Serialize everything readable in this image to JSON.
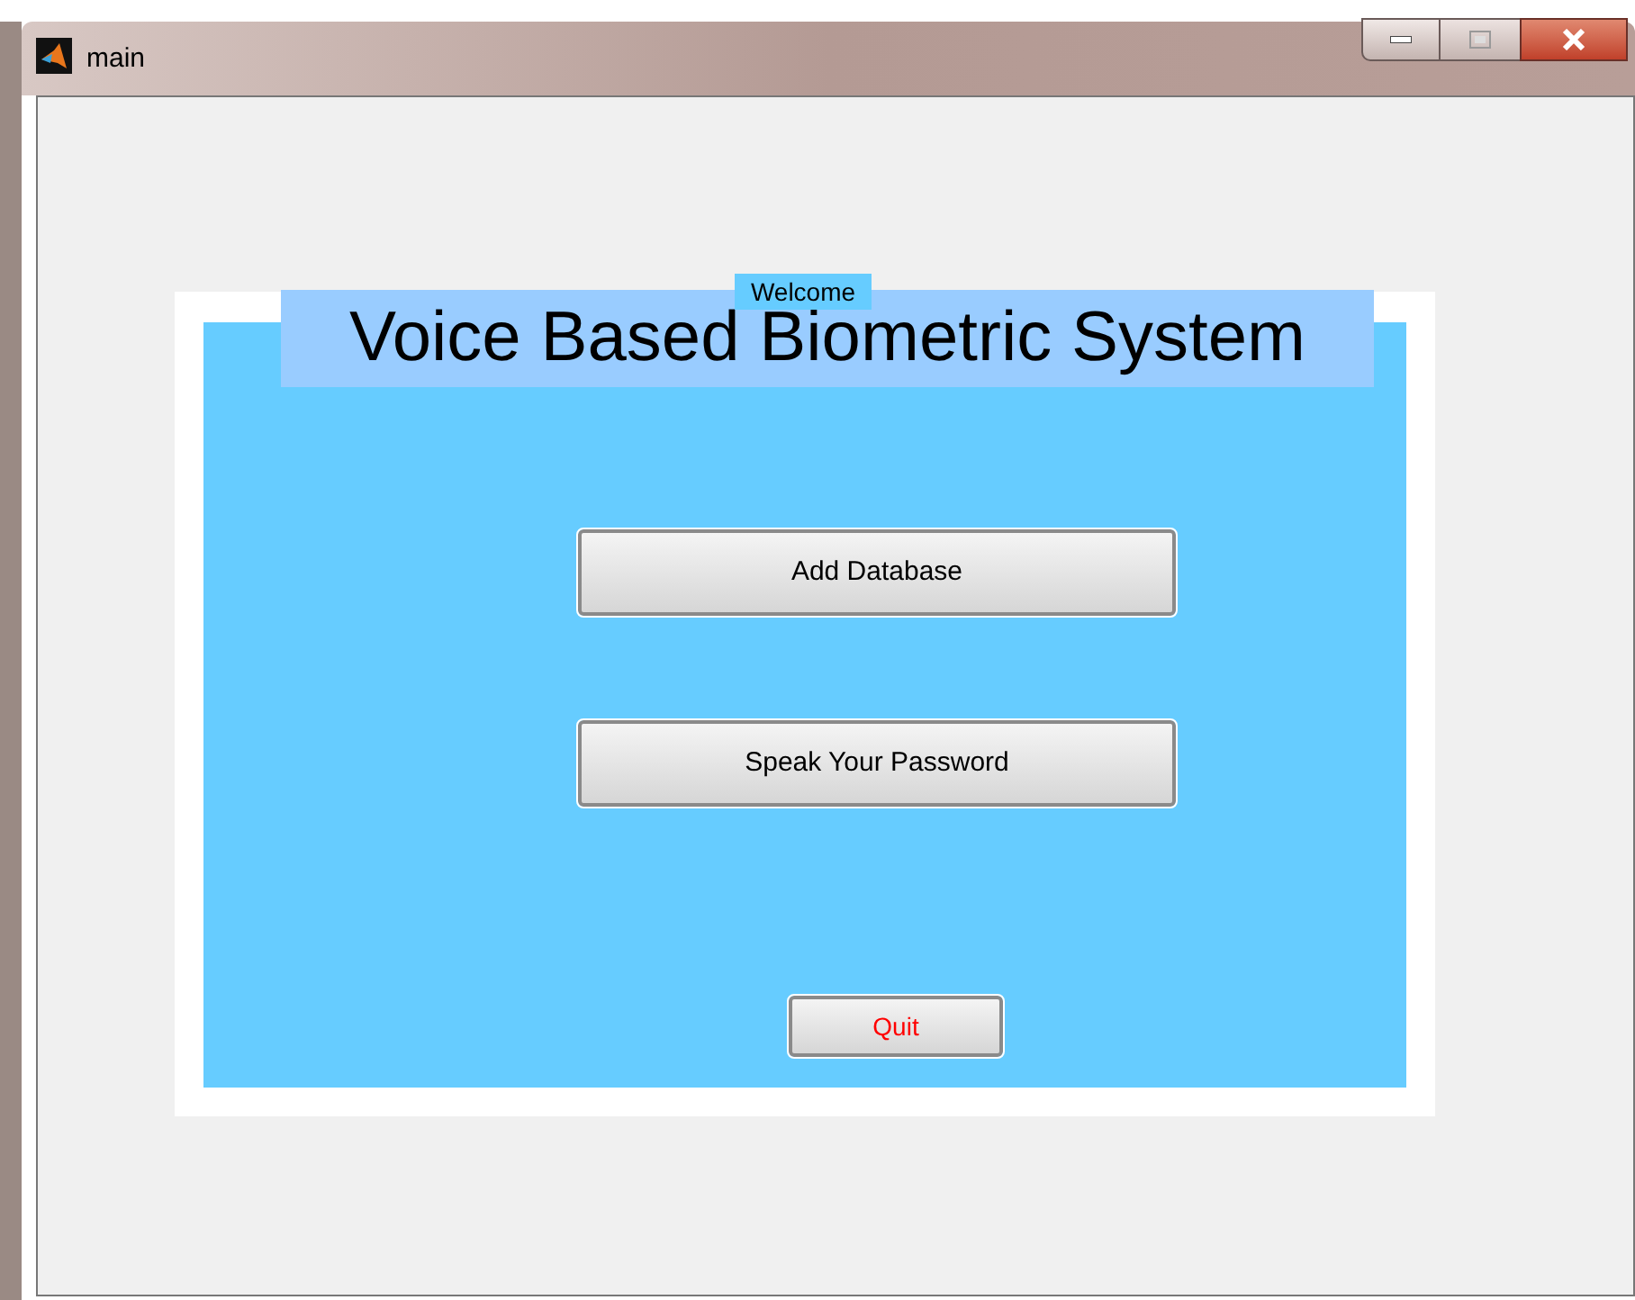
{
  "window": {
    "title": "main"
  },
  "panel": {
    "title": "Voice Based Biometric System",
    "label": "Welcome"
  },
  "buttons": [
    {
      "label": "Add Database",
      "color": "#000000"
    },
    {
      "label": "Speak Your Password",
      "color": "#000000"
    },
    {
      "label": "Quit",
      "color": "#ff0000"
    }
  ]
}
